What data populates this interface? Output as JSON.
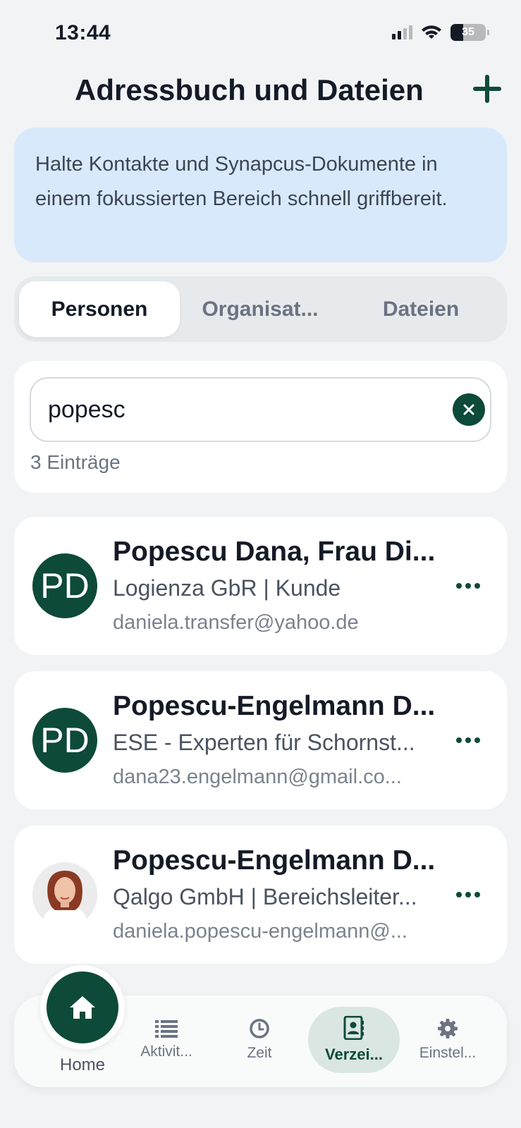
{
  "status_bar": {
    "time": "13:44",
    "battery": "35"
  },
  "header": {
    "title": "Adressbuch und Dateien",
    "add_icon": "plus-icon"
  },
  "info_banner": {
    "text": "Halte Kontakte und Synapcus-Dokumente in einem fokussierten Bereich schnell griffbereit."
  },
  "tabs": [
    {
      "label": "Personen",
      "active": true
    },
    {
      "label": "Organisat...",
      "active": false
    },
    {
      "label": "Dateien",
      "active": false
    }
  ],
  "search": {
    "value": "popesc",
    "placeholder": "",
    "clear_icon": "close-icon",
    "result_count": "3 Einträge"
  },
  "contacts": [
    {
      "initials": "PD",
      "name": "Popescu Dana, Frau Di...",
      "subtitle": "Logienza GbR | Kunde",
      "email": "daniela.transfer@yahoo.de",
      "has_photo": false
    },
    {
      "initials": "PD",
      "name": "Popescu-Engelmann D...",
      "subtitle": "ESE - Experten für Schornst...",
      "email": "dana23.engelmann@gmail.co...",
      "has_photo": false
    },
    {
      "initials": "",
      "name": "Popescu-Engelmann D...",
      "subtitle": "Qalgo GmbH | Bereichsleiter...",
      "email": "daniela.popescu-engelmann@...",
      "has_photo": true
    }
  ],
  "bottom_nav": {
    "home": {
      "label": "Home",
      "icon": "home-icon"
    },
    "items": [
      {
        "label": "Aktivit...",
        "icon": "list-icon",
        "active": false
      },
      {
        "label": "Zeit",
        "icon": "clock-icon",
        "active": false
      },
      {
        "label": "Verzei...",
        "icon": "contact-book-icon",
        "active": true
      },
      {
        "label": "Einstel...",
        "icon": "gear-icon",
        "active": false
      }
    ]
  },
  "colors": {
    "accent": "#0d4a3a",
    "banner": "#d8e9fb",
    "background": "#f2f3f5",
    "active_nav_bg": "#dae6e1"
  }
}
